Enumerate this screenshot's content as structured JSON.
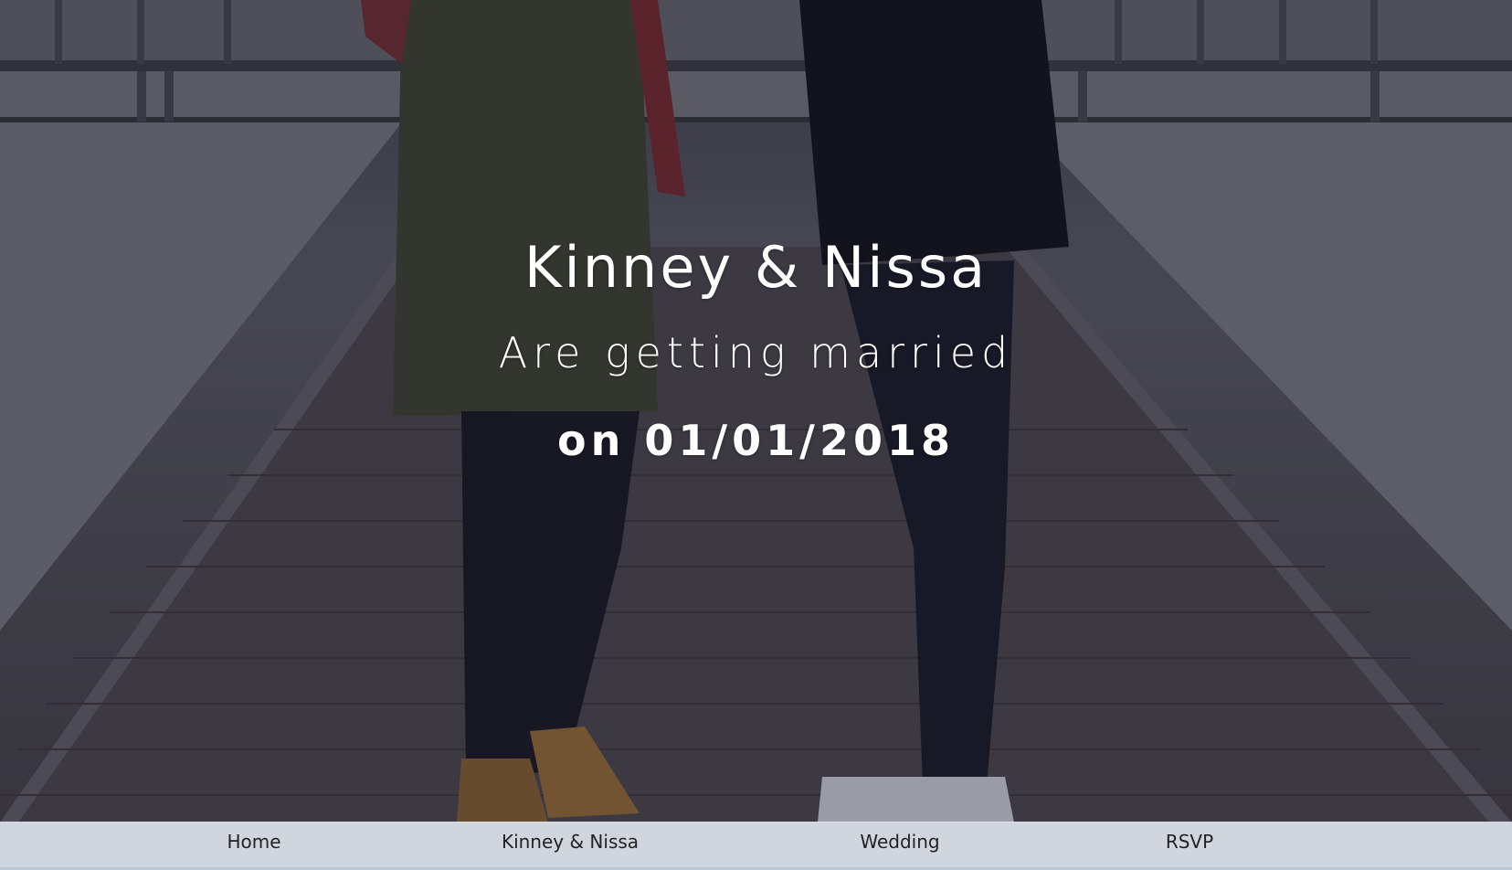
{
  "hero": {
    "names": "Kinney & Nissa",
    "subtitle": "Are getting married",
    "date_line": "on 01/01/2018",
    "background_description_icon": "couple-on-boardwalk-photo"
  },
  "nav": {
    "items": [
      {
        "label": "Home"
      },
      {
        "label": "Kinney & Nissa"
      },
      {
        "label": "Wedding"
      },
      {
        "label": "RSVP"
      }
    ]
  },
  "colors": {
    "hero_text": "#ffffff",
    "nav_background": "#ebf0f8",
    "nav_text": "#222222",
    "nav_border": "#b9c9dc"
  }
}
